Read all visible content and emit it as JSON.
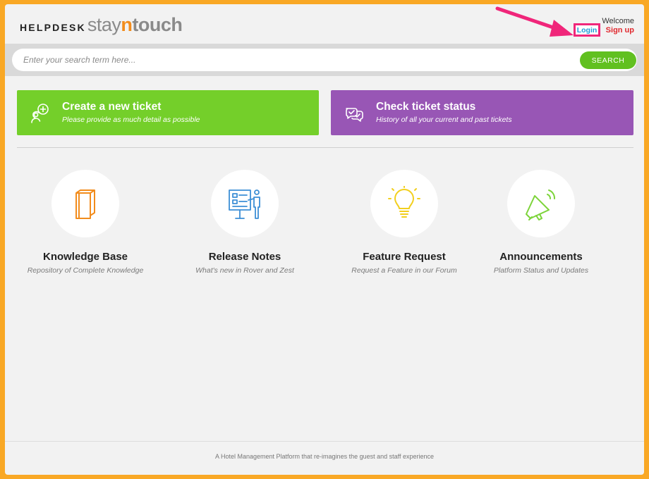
{
  "header": {
    "logo_helpdesk": "HELPDESK",
    "logo_stay": "stay",
    "logo_n": "n",
    "logo_touch": "touch",
    "welcome": "Welcome",
    "login": "Login",
    "signup": "Sign up"
  },
  "search": {
    "placeholder": "Enter your search term here...",
    "button": "SEARCH"
  },
  "actions": [
    {
      "title": "Create a new ticket",
      "subtitle": "Please provide as much detail as possible",
      "color": "#74cf2a",
      "icon": "chat-bubble-plus-icon"
    },
    {
      "title": "Check ticket status",
      "subtitle": "History of all your current and past tickets",
      "color": "#9856b5",
      "icon": "chat-bubbles-check-icon"
    }
  ],
  "tiles": [
    {
      "title": "Knowledge Base",
      "subtitle": "Repository of Complete Knowledge",
      "icon": "book-icon",
      "color": "#f28c1c"
    },
    {
      "title": "Release Notes",
      "subtitle": "What's new in Rover and Zest",
      "icon": "presentation-board-icon",
      "color": "#3d8fd6"
    },
    {
      "title": "Feature Request",
      "subtitle": "Request a Feature in our Forum",
      "icon": "light-bulb-icon",
      "color": "#f2cf1d"
    },
    {
      "title": "Announcements",
      "subtitle": "Platform Status and Updates",
      "icon": "megaphone-icon",
      "color": "#7dd43a"
    }
  ],
  "footer": {
    "text": "A Hotel Management Platform that re-imagines the guest and staff experience"
  },
  "colors": {
    "background_border": "#f9a825",
    "accent_green": "#61c020",
    "highlight_pink": "#f0267a",
    "signup_red": "#e0282e",
    "login_blue": "#1e9bd7"
  }
}
